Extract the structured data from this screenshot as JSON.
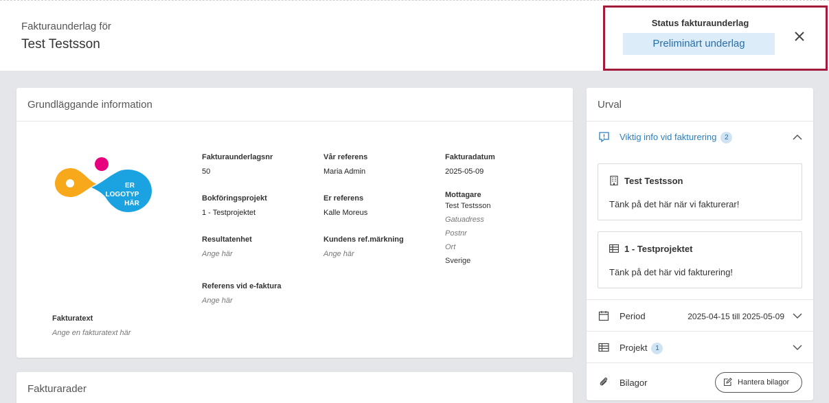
{
  "header": {
    "pre_title": "Fakturaunderlag för",
    "customer_name": "Test Testsson",
    "status_label": "Status fakturaunderlag",
    "status_value": "Preliminärt underlag"
  },
  "basic_info": {
    "title": "Grundläggande information",
    "logo_text": [
      "ER",
      "LOGOTYP",
      "HÄR"
    ],
    "fields": {
      "fakturaunderlagsnr": {
        "label": "Fakturaunderlagsnr",
        "value": "50"
      },
      "var_referens": {
        "label": "Vår referens",
        "value": "Maria Admin"
      },
      "fakturadatum": {
        "label": "Fakturadatum",
        "value": "2025-05-09"
      },
      "bokforingsprojekt": {
        "label": "Bokföringsprojekt",
        "value": "1 - Testprojektet"
      },
      "er_referens": {
        "label": "Er referens",
        "value": "Kalle Moreus"
      },
      "resultatenhet": {
        "label": "Resultatenhet",
        "placeholder": "Ange här"
      },
      "kundens_ref": {
        "label": "Kundens ref.märkning",
        "placeholder": "Ange här"
      },
      "referens_efaktura": {
        "label": "Referens vid e-faktura",
        "placeholder": "Ange här"
      },
      "fakturatext": {
        "label": "Fakturatext",
        "placeholder": "Ange en fakturatext här"
      }
    },
    "recipient": {
      "label": "Mottagare",
      "name": "Test Testsson",
      "street_placeholder": "Gatuadress",
      "postal_placeholder": "Postnr",
      "city_placeholder": "Ort",
      "country": "Sverige"
    }
  },
  "invoice_rows": {
    "title": "Fakturarader"
  },
  "sidebar": {
    "title": "Urval",
    "important": {
      "label": "Viktig info vid fakturering",
      "count": "2"
    },
    "notes": [
      {
        "title": "Test Testsson",
        "message": "Tänk på det här när vi fakturerar!",
        "icon": "building-icon"
      },
      {
        "title": "1 - Testprojektet",
        "message": "Tänk på det här vid fakturering!",
        "icon": "table-icon"
      }
    ],
    "period": {
      "label": "Period",
      "value": "2025-04-15 till 2025-05-09"
    },
    "project": {
      "label": "Projekt",
      "count": "1"
    },
    "attachments": {
      "label": "Bilagor",
      "button": "Hantera bilagor"
    }
  },
  "colors": {
    "accent": "#2a7fc1",
    "status_bg": "#dcecf8",
    "highlight_border": "#a31a3b",
    "logo_orange": "#f7a81b",
    "logo_pink": "#e6007e",
    "logo_blue": "#1aa3e0"
  }
}
